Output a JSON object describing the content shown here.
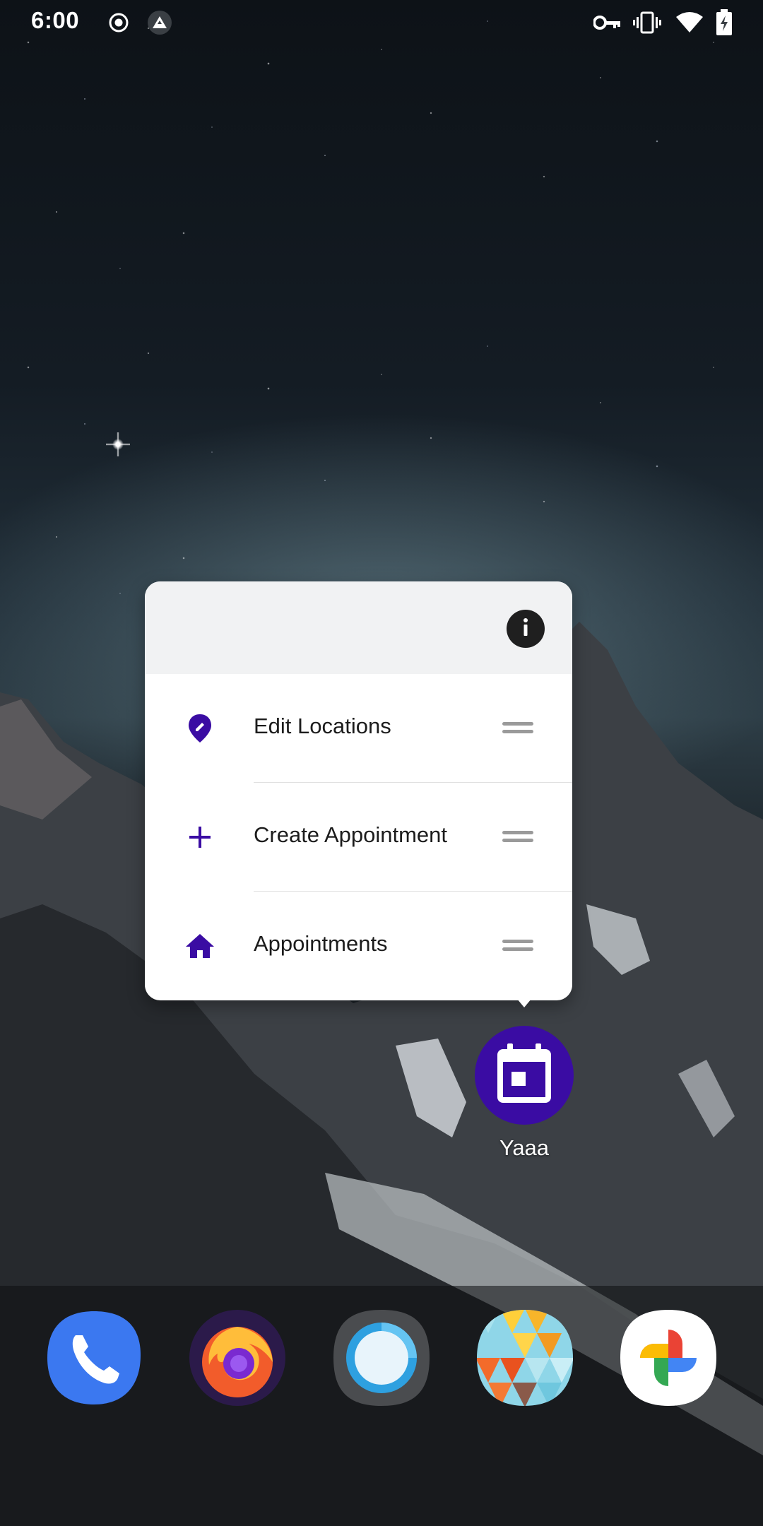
{
  "status_bar": {
    "time": "6:00",
    "left_icons": [
      "record-icon",
      "vpn-shield-icon"
    ],
    "right_icons": [
      "key-icon",
      "vibrate-icon",
      "wifi-icon",
      "battery-charging-icon"
    ]
  },
  "shortcut_menu": {
    "header_icon": "info-icon",
    "items": [
      {
        "label": "Edit Locations",
        "icon": "edit-location-icon"
      },
      {
        "label": "Create Appointment",
        "icon": "plus-icon"
      },
      {
        "label": "Appointments",
        "icon": "home-icon"
      }
    ],
    "accent_color": "#3a0ca3"
  },
  "app": {
    "name": "Yaaa",
    "icon": "calendar-icon",
    "color": "#3a0ca3"
  },
  "dock": {
    "apps": [
      {
        "name": "Phone",
        "icon": "phone-icon"
      },
      {
        "name": "Firefox",
        "icon": "firefox-icon"
      },
      {
        "name": "Signal",
        "icon": "circle-app-icon"
      },
      {
        "name": "Wallpaper",
        "icon": "triangles-icon"
      },
      {
        "name": "Photos",
        "icon": "pinwheel-icon"
      }
    ]
  }
}
